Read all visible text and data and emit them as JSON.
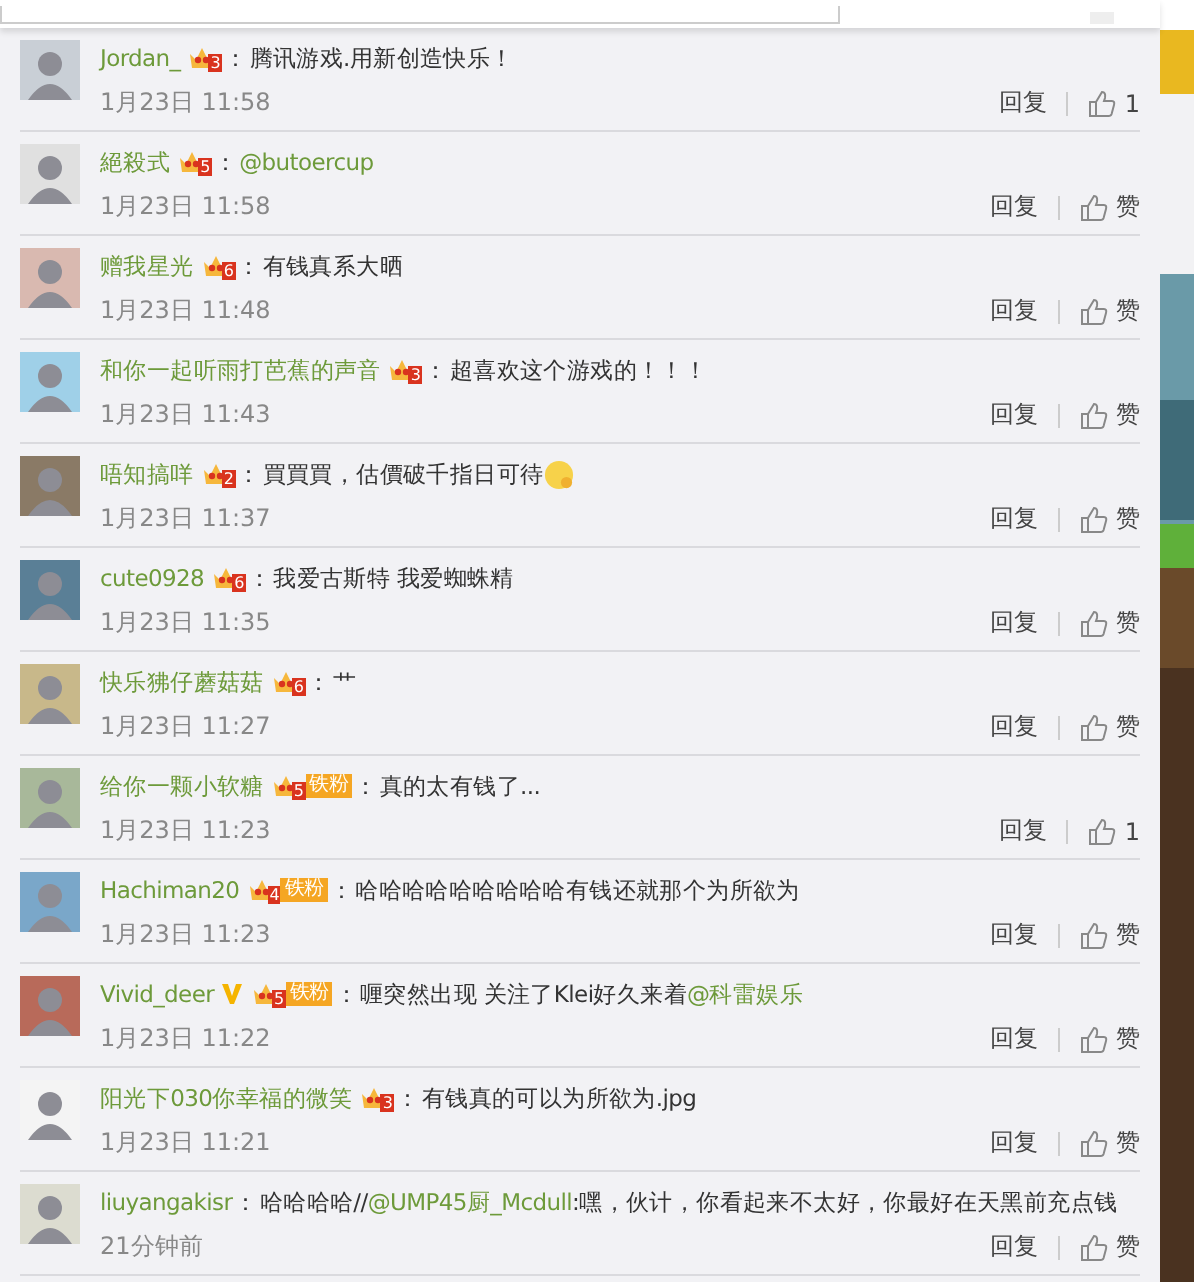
{
  "comments": [
    {
      "name": "Jordan_",
      "separator": "：",
      "badge": {
        "level": "3"
      },
      "content": [
        {
          "kind": "text",
          "text": "腾讯游戏.用新创造快乐！"
        }
      ],
      "time": "1月23日 11:58",
      "reply": "回复",
      "like": "1"
    },
    {
      "name": "絕殺式",
      "separator": "：",
      "badge": {
        "level": "5"
      },
      "content": [
        {
          "kind": "mention",
          "text": "@butoercup"
        }
      ],
      "time": "1月23日 11:58",
      "reply": "回复",
      "like": "赞"
    },
    {
      "name": "赠我星光",
      "separator": "：",
      "badge": {
        "level": "6"
      },
      "content": [
        {
          "kind": "text",
          "text": "有钱真系大晒"
        }
      ],
      "time": "1月23日 11:48",
      "reply": "回复",
      "like": "赞"
    },
    {
      "name": "和你一起听雨打芭蕉的声音",
      "separator": "：",
      "badge": {
        "level": "3"
      },
      "content": [
        {
          "kind": "text",
          "text": "超喜欢这个游戏的！！！"
        }
      ],
      "time": "1月23日 11:43",
      "reply": "回复",
      "like": "赞"
    },
    {
      "name": "唔知搞咩",
      "separator": "：",
      "badge": {
        "level": "2"
      },
      "content": [
        {
          "kind": "text",
          "text": "買買買，估價破千指日可待"
        },
        {
          "kind": "emoji"
        }
      ],
      "time": "1月23日 11:37",
      "reply": "回复",
      "like": "赞"
    },
    {
      "name": "cute0928",
      "separator": "：",
      "badge": {
        "level": "6"
      },
      "content": [
        {
          "kind": "text",
          "text": "我爱古斯特 我爱蜘蛛精"
        }
      ],
      "time": "1月23日 11:35",
      "reply": "回复",
      "like": "赞"
    },
    {
      "name": "快乐狒仔蘑菇菇",
      "separator": "：",
      "badge": {
        "level": "6"
      },
      "content": [
        {
          "kind": "text",
          "text": "艹"
        }
      ],
      "time": "1月23日 11:27",
      "reply": "回复",
      "like": "赞"
    },
    {
      "name": "给你一颗小软糖",
      "separator": "：",
      "badge": {
        "level": "5",
        "fan_tag": "铁粉"
      },
      "content": [
        {
          "kind": "text",
          "text": "真的太有钱了..."
        }
      ],
      "time": "1月23日 11:23",
      "reply": "回复",
      "like": "1"
    },
    {
      "name": "Hachiman20",
      "separator": "：",
      "badge": {
        "level": "4",
        "fan_tag": "铁粉"
      },
      "content": [
        {
          "kind": "text",
          "text": "哈哈哈哈哈哈哈哈哈有钱还就那个为所欲为"
        }
      ],
      "time": "1月23日 11:23",
      "reply": "回复",
      "like": "赞"
    },
    {
      "name": "Vivid_deer",
      "verified": true,
      "separator": "：",
      "badge": {
        "level": "5",
        "fan_tag": "铁粉"
      },
      "content": [
        {
          "kind": "text",
          "text": "喱突然出现 关注了Klei好久来着"
        },
        {
          "kind": "mention",
          "text": "@科雷娱乐"
        }
      ],
      "time": "1月23日 11:22",
      "reply": "回复",
      "like": "赞"
    },
    {
      "name": "阳光下030你幸福的微笑",
      "separator": "：",
      "badge": {
        "level": "3"
      },
      "content": [
        {
          "kind": "text",
          "text": "有钱真的可以为所欲为.jpg"
        }
      ],
      "time": "1月23日 11:21",
      "reply": "回复",
      "like": "赞"
    },
    {
      "name": "liuyangakisr",
      "separator": "：",
      "content": [
        {
          "kind": "text",
          "text": "哈哈哈哈//"
        },
        {
          "kind": "mention",
          "text": "@UMP45厨_Mcdull"
        },
        {
          "kind": "text",
          "text": " :嘿，伙计，你看起来不太好，你最好在天黑前充点钱"
        }
      ],
      "time": "21分钟前",
      "reply": "回复",
      "like": "赞"
    }
  ]
}
